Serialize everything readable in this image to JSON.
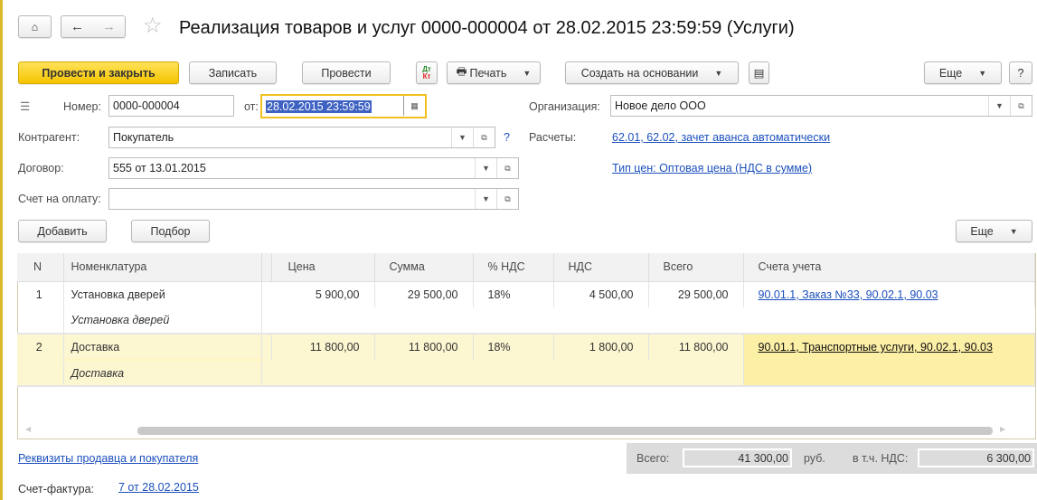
{
  "window": {
    "title": "Реализация товаров и услуг 0000-000004 от 28.02.2015 23:59:59 (Услуги)"
  },
  "toolbar": {
    "post_close": "Провести и закрыть",
    "save": "Записать",
    "post": "Провести",
    "dtkt_top": "Дт",
    "dtkt_bottom": "Кт",
    "print": "Печать",
    "create_based": "Создать на основании",
    "more": "Еще",
    "help": "?"
  },
  "form": {
    "number_label": "Номер:",
    "number": "0000-000004",
    "date_label": "от:",
    "date": "28.02.2015 23:59:59",
    "org_label": "Организация:",
    "org": "Новое дело ООО",
    "counterparty_label": "Контрагент:",
    "counterparty": "Покупатель",
    "q": "?",
    "settlements_label": "Расчеты:",
    "settlements": "62.01, 62.02, зачет аванса автоматически",
    "contract_label": "Договор:",
    "contract": "555 от 13.01.2015",
    "price_type": "Тип цен: Оптовая цена (НДС в сумме)",
    "invoice_label": "Счет на оплату:",
    "invoice": ""
  },
  "table_toolbar": {
    "add": "Добавить",
    "pick": "Подбор",
    "more": "Еще"
  },
  "table": {
    "columns": [
      "N",
      "Номенклатура",
      "Цена",
      "Сумма",
      "% НДС",
      "НДС",
      "Всего",
      "Счета учета"
    ],
    "rows": [
      {
        "n": "1",
        "item": "Установка дверей",
        "item_sub": "Установка дверей",
        "price": "5 900,00",
        "sum": "29 500,00",
        "vat_rate": "18%",
        "vat": "4 500,00",
        "total": "29 500,00",
        "accounts": "90.01.1, Заказ №33, 90.02.1, 90.03"
      },
      {
        "n": "2",
        "item": "Доставка",
        "item_sub": "Доставка",
        "price": "11 800,00",
        "sum": "11 800,00",
        "vat_rate": "18%",
        "vat": "1 800,00",
        "total": "11 800,00",
        "accounts": "90.01.1, Транспортные услуги, 90.02.1, 90.03"
      }
    ]
  },
  "footer": {
    "requisites": "Реквизиты продавца и покупателя",
    "total_label": "Всего:",
    "total": "41 300,00",
    "currency": "руб.",
    "vat_label": "в т.ч. НДС:",
    "vat": "6 300,00",
    "sf_label": "Счет-фактура:",
    "sf": "7 от 28.02.2015"
  },
  "colors": {
    "accent": "#f5c400",
    "link": "#1b4fbd",
    "selected_row": "#fcf6d1"
  }
}
